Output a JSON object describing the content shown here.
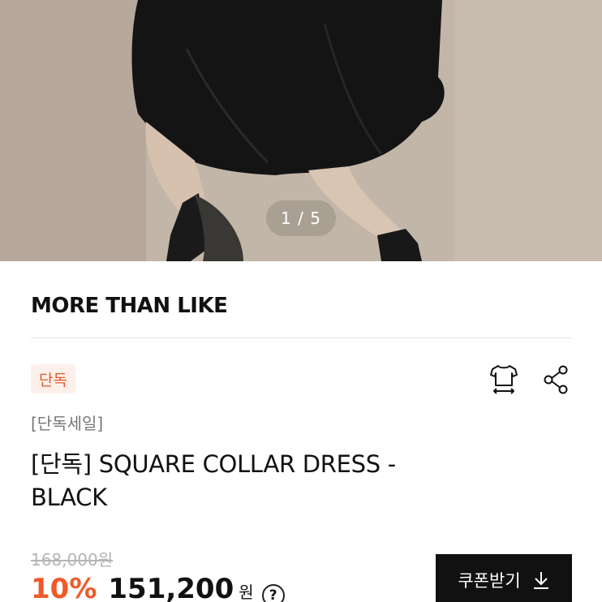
{
  "gallery": {
    "counter": "1 / 5"
  },
  "brand": {
    "name": "MORE THAN LIKE"
  },
  "badge": {
    "label": "단독"
  },
  "actions": {
    "fit_icon": "tshirt-size-icon",
    "share_icon": "share-icon"
  },
  "product": {
    "subtitle": "[단독세일]",
    "title": "[단독] SQUARE COLLAR DRESS - BLACK"
  },
  "pricing": {
    "original": "168,000원",
    "discount": "10%",
    "price": "151,200",
    "currency": "원",
    "help": "?"
  },
  "coupon": {
    "label": "쿠폰받기",
    "icon": "download-icon"
  },
  "colors": {
    "accent": "#ef5a2a",
    "badge_bg": "#fdf0ea",
    "button_bg": "#111111"
  }
}
